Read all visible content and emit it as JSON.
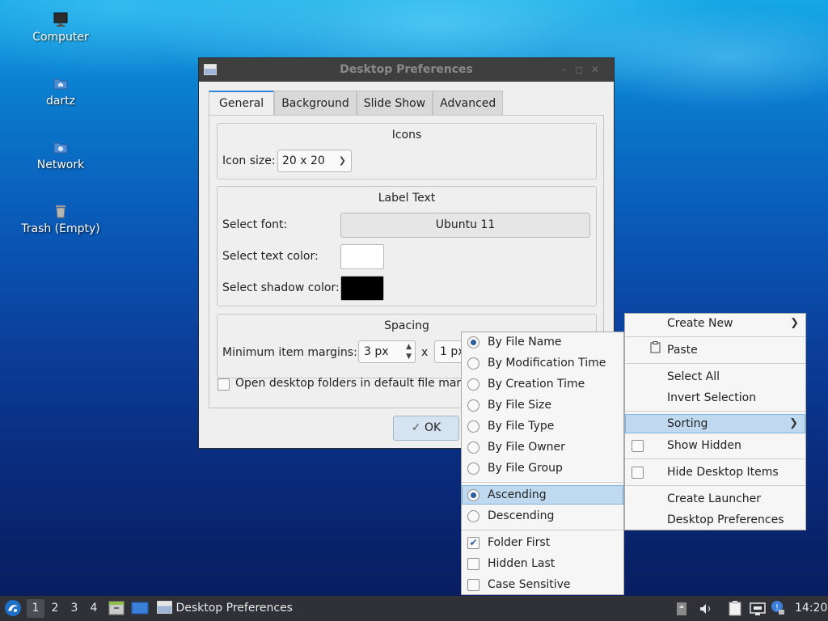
{
  "desktop": {
    "icons": [
      {
        "label": "Computer",
        "icon": "monitor-icon"
      },
      {
        "label": "dartz",
        "icon": "home-folder-icon"
      },
      {
        "label": "Network",
        "icon": "network-folder-icon"
      },
      {
        "label": "Trash (Empty)",
        "icon": "trash-icon"
      }
    ]
  },
  "window": {
    "title": "Desktop Preferences",
    "tabs": [
      "General",
      "Background",
      "Slide Show",
      "Advanced"
    ],
    "active_tab": "General",
    "icons_group": {
      "title": "Icons",
      "icon_size_label": "Icon size:",
      "icon_size_value": "20 x 20"
    },
    "label_group": {
      "title": "Label Text",
      "font_label": "Select font:",
      "font_value": "Ubuntu 11",
      "text_color_label": "Select text color:",
      "text_color": "#ffffff",
      "shadow_color_label": "Select shadow color:",
      "shadow_color": "#000000"
    },
    "spacing_group": {
      "title": "Spacing",
      "margins_label": "Minimum item margins:",
      "margin_x": "3 px",
      "times": "x",
      "margin_y": "1 px"
    },
    "open_in_fm_label": "Open desktop folders in default file mana",
    "ok_label": "OK"
  },
  "context_menu": {
    "items": [
      {
        "label": "Create New",
        "submenu": true
      },
      {
        "label": "Paste",
        "icon": "clipboard-icon"
      },
      {
        "label": "Select All"
      },
      {
        "label": "Invert Selection"
      },
      {
        "label": "Sorting",
        "submenu": true,
        "highlighted": true
      },
      {
        "label": "Show Hidden",
        "checkbox": true,
        "checked": false
      },
      {
        "label": "Hide Desktop Items",
        "checkbox": true,
        "checked": false
      },
      {
        "label": "Create Launcher"
      },
      {
        "label": "Desktop Preferences"
      }
    ]
  },
  "sorting_menu": {
    "sort_by": [
      {
        "label": "By File Name",
        "selected": true
      },
      {
        "label": "By Modification Time",
        "selected": false
      },
      {
        "label": "By Creation Time",
        "selected": false
      },
      {
        "label": "By File Size",
        "selected": false
      },
      {
        "label": "By File Type",
        "selected": false
      },
      {
        "label": "By File Owner",
        "selected": false
      },
      {
        "label": "By File Group",
        "selected": false
      }
    ],
    "order": [
      {
        "label": "Ascending",
        "selected": true
      },
      {
        "label": "Descending",
        "selected": false
      }
    ],
    "options": [
      {
        "label": "Folder First",
        "checked": true
      },
      {
        "label": "Hidden Last",
        "checked": false
      },
      {
        "label": "Case Sensitive",
        "checked": false
      }
    ]
  },
  "taskbar": {
    "workspaces": [
      "1",
      "2",
      "3",
      "4"
    ],
    "active_workspace": "1",
    "task_label": "Desktop Preferences",
    "clock": "14:20"
  },
  "colors": {
    "accent": "#2f86d8",
    "menu_highlight": "#bfdaf0",
    "taskbar": "#2f3136",
    "titlebar": "#3f3f40"
  }
}
